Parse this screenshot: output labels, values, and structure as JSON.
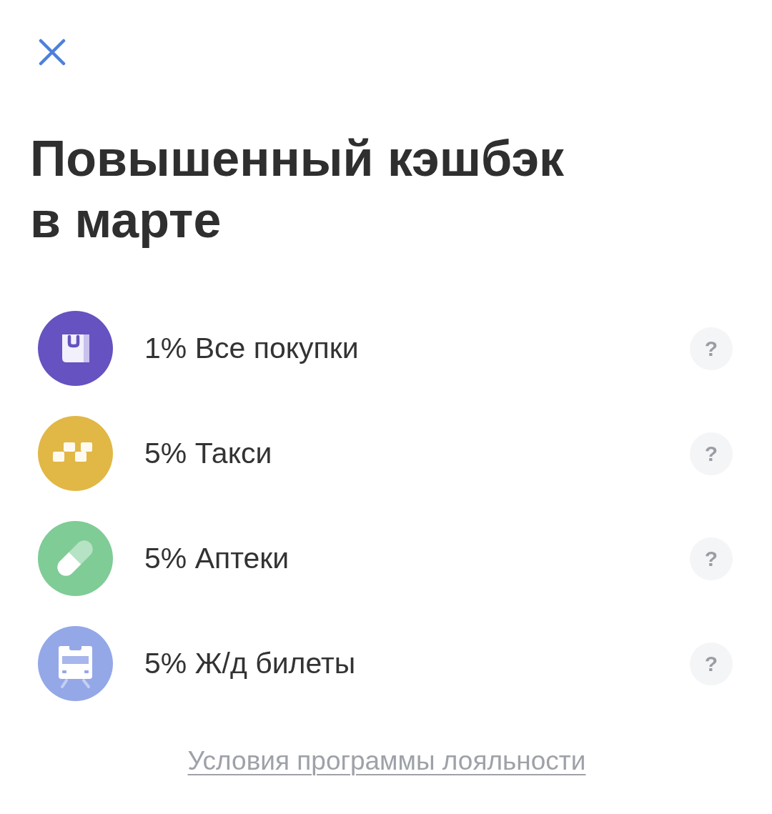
{
  "close_button": {
    "kind": "close"
  },
  "title": "Повышенный кэшбэк в марте",
  "cashback_items": [
    {
      "kind": "bag",
      "color": "#6652c0",
      "label": "1% Все покупки",
      "help": "?"
    },
    {
      "kind": "taxi",
      "color": "#e1b746",
      "label": "5% Такси",
      "help": "?"
    },
    {
      "kind": "pill",
      "color": "#7fcc96",
      "label": "5% Аптеки",
      "help": "?"
    },
    {
      "kind": "train",
      "color": "#94a8e8",
      "label": "5% Ж/д билеты",
      "help": "?"
    }
  ],
  "footer_link": "Условия программы лояльности"
}
